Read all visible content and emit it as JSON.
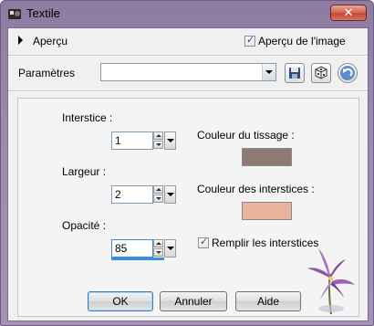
{
  "window": {
    "title": "Textile",
    "close_label": "✕"
  },
  "preview": {
    "label": "Aperçu",
    "image_preview_label": "Aperçu de l'image",
    "image_preview_checked": true
  },
  "params": {
    "label": "Paramètres",
    "preset_value": ""
  },
  "fields": {
    "interstice": {
      "label": "Interstice :",
      "value": "1"
    },
    "largeur": {
      "label": "Largeur :",
      "value": "2"
    },
    "opacite": {
      "label": "Opacité :",
      "value": "85"
    }
  },
  "colors": {
    "weave_label": "Couleur du tissage :",
    "weave_color": "#8f7a73",
    "gap_label": "Couleur des interstices :",
    "gap_color": "#e8b49c"
  },
  "fill_gaps": {
    "label": "Remplir les interstices",
    "checked": true
  },
  "buttons": {
    "ok": "OK",
    "cancel": "Annuler",
    "help": "Aide"
  }
}
